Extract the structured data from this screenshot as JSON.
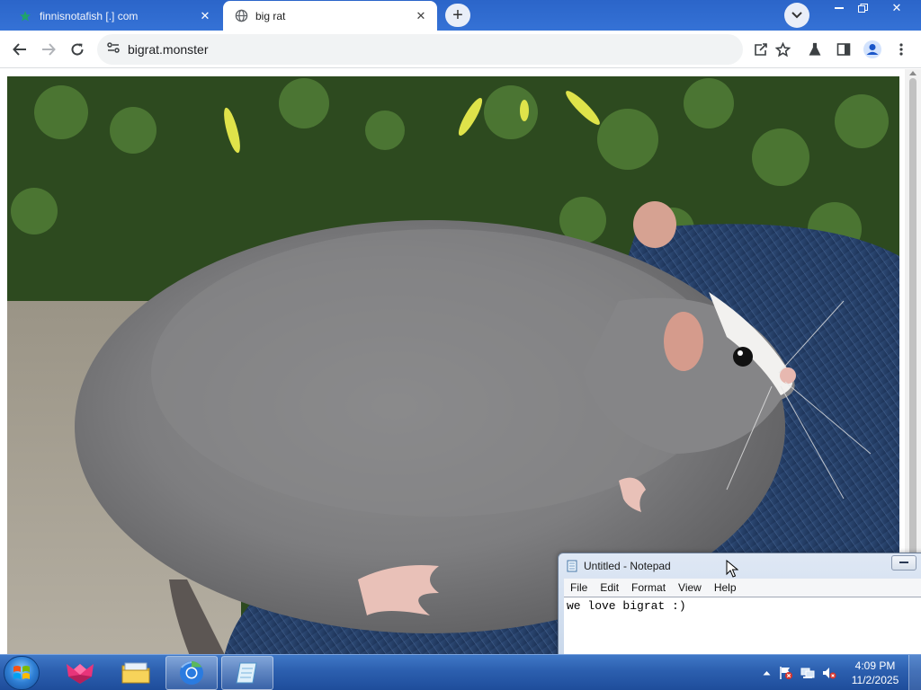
{
  "browser": {
    "tabs": [
      {
        "title": "finnisnotafish [.] com",
        "active": false,
        "favicon": "green-star-favicon"
      },
      {
        "title": "big rat",
        "active": true,
        "favicon": "globe-icon"
      }
    ],
    "url": "bigrat.monster",
    "accent_color": "#2b65c9"
  },
  "page": {
    "image_alt": "photo of a very large grey rat with a white face patch sitting on blue denim jeans, green leaves and yellow flowers behind"
  },
  "notepad": {
    "title": "Untitled - Notepad",
    "menus": [
      "File",
      "Edit",
      "Format",
      "View",
      "Help"
    ],
    "content": "we love bigrat :)"
  },
  "taskbar": {
    "apps": [
      {
        "name": "origami-cat-app",
        "open": false
      },
      {
        "name": "file-explorer",
        "open": false
      },
      {
        "name": "chrome",
        "open": true
      },
      {
        "name": "notepad",
        "open": true
      }
    ],
    "clock_time": "4:09 PM",
    "clock_date": "11/2/2025"
  }
}
